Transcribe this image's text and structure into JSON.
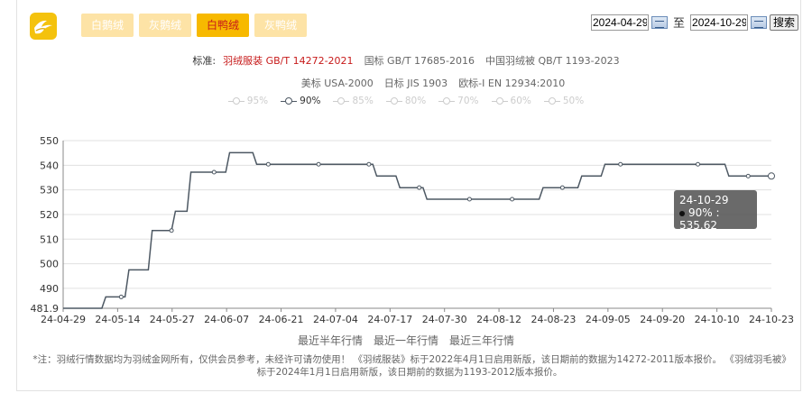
{
  "tabs": [
    {
      "label": "白鹅绒",
      "active": false
    },
    {
      "label": "灰鹅绒",
      "active": false
    },
    {
      "label": "白鸭绒",
      "active": true
    },
    {
      "label": "灰鸭绒",
      "active": false
    }
  ],
  "date_range": {
    "start": "2024-04-29",
    "separator": "至",
    "end": "2024-10-29",
    "search_label": "搜索"
  },
  "standards": {
    "label": "标准:",
    "row1": [
      "羽绒服装 GB/T 14272-2021",
      "国标 GB/T 17685-2016",
      "中国羽绒被 QB/T 1193-2023"
    ],
    "row2": [
      "美标 USA-2000",
      "日标 JIS 1903",
      "欧标-I EN 12934:2010"
    ],
    "active": "羽绒服装 GB/T 14272-2021"
  },
  "legend": [
    {
      "label": "95%",
      "active": false
    },
    {
      "label": "90%",
      "active": true
    },
    {
      "label": "85%",
      "active": false
    },
    {
      "label": "80%",
      "active": false
    },
    {
      "label": "70%",
      "active": false
    },
    {
      "label": "60%",
      "active": false
    },
    {
      "label": "50%",
      "active": false
    }
  ],
  "range_links": [
    "最近半年行情",
    "最近一年行情",
    "最近三年行情"
  ],
  "note": "*注：羽绒行情数据均为羽绒金网所有，仅供会员参考，未经许可请勿使用！ 《羽绒服装》标于2022年4月1日启用新版，该日期前的数据为14272-2011版本报价。 《羽绒羽毛被》标于2024年1月1日启用新版，该日期前的数据为1193-2012版本报价。",
  "tooltip": {
    "date": "24-10-29",
    "series": "90%",
    "value": "535.62"
  },
  "colors": {
    "tab_active_bg": "#f7b900",
    "tab_bg": "#fde3a6",
    "active_red": "#c71a1a",
    "line": "#4d5863"
  },
  "chart_data": {
    "type": "line",
    "series_name": "90%",
    "x_tick_labels": [
      "24-04-29",
      "24-05-14",
      "24-05-27",
      "24-06-07",
      "24-06-21",
      "24-07-04",
      "24-07-17",
      "24-07-30",
      "24-08-12",
      "24-08-23",
      "24-09-05",
      "24-09-20",
      "24-10-10",
      "24-10-23"
    ],
    "y_ticks": [
      481.9,
      490,
      500,
      510,
      520,
      530,
      540,
      550
    ],
    "ylim": [
      481.9,
      550
    ],
    "grid": true,
    "steps": [
      {
        "date": "2024-04-29",
        "value": 481.9
      },
      {
        "date": "2024-05-09",
        "value": 481.9
      },
      {
        "date": "2024-05-10",
        "value": 486.5
      },
      {
        "date": "2024-05-15",
        "value": 486.5
      },
      {
        "date": "2024-05-16",
        "value": 497.5
      },
      {
        "date": "2024-05-21",
        "value": 497.5
      },
      {
        "date": "2024-05-22",
        "value": 513.5
      },
      {
        "date": "2024-05-27",
        "value": 513.5
      },
      {
        "date": "2024-05-28",
        "value": 521.3
      },
      {
        "date": "2024-05-31",
        "value": 521.3
      },
      {
        "date": "2024-06-01",
        "value": 537.2
      },
      {
        "date": "2024-06-10",
        "value": 537.2
      },
      {
        "date": "2024-06-11",
        "value": 545.1
      },
      {
        "date": "2024-06-17",
        "value": 545.1
      },
      {
        "date": "2024-06-18",
        "value": 540.4
      },
      {
        "date": "2024-07-18",
        "value": 540.4
      },
      {
        "date": "2024-07-19",
        "value": 535.6
      },
      {
        "date": "2024-07-24",
        "value": 535.6
      },
      {
        "date": "2024-07-25",
        "value": 530.9
      },
      {
        "date": "2024-07-31",
        "value": 530.9
      },
      {
        "date": "2024-08-01",
        "value": 526.2
      },
      {
        "date": "2024-08-30",
        "value": 526.2
      },
      {
        "date": "2024-08-31",
        "value": 530.9
      },
      {
        "date": "2024-09-09",
        "value": 530.9
      },
      {
        "date": "2024-09-10",
        "value": 535.6
      },
      {
        "date": "2024-09-15",
        "value": 535.6
      },
      {
        "date": "2024-09-16",
        "value": 540.4
      },
      {
        "date": "2024-10-17",
        "value": 540.4
      },
      {
        "date": "2024-10-18",
        "value": 535.6
      },
      {
        "date": "2024-10-29",
        "value": 535.62
      }
    ],
    "markers": [
      {
        "date": "2024-05-14",
        "value": 486.5
      },
      {
        "date": "2024-05-27",
        "value": 513.5
      },
      {
        "date": "2024-06-07",
        "value": 537.2
      },
      {
        "date": "2024-06-21",
        "value": 540.4
      },
      {
        "date": "2024-07-04",
        "value": 540.4
      },
      {
        "date": "2024-07-17",
        "value": 540.4
      },
      {
        "date": "2024-07-30",
        "value": 530.9
      },
      {
        "date": "2024-08-12",
        "value": 526.2
      },
      {
        "date": "2024-08-23",
        "value": 526.2
      },
      {
        "date": "2024-09-05",
        "value": 530.9
      },
      {
        "date": "2024-09-20",
        "value": 540.4
      },
      {
        "date": "2024-10-10",
        "value": 540.4
      },
      {
        "date": "2024-10-23",
        "value": 535.6
      },
      {
        "date": "2024-10-29",
        "value": 535.62
      }
    ]
  }
}
